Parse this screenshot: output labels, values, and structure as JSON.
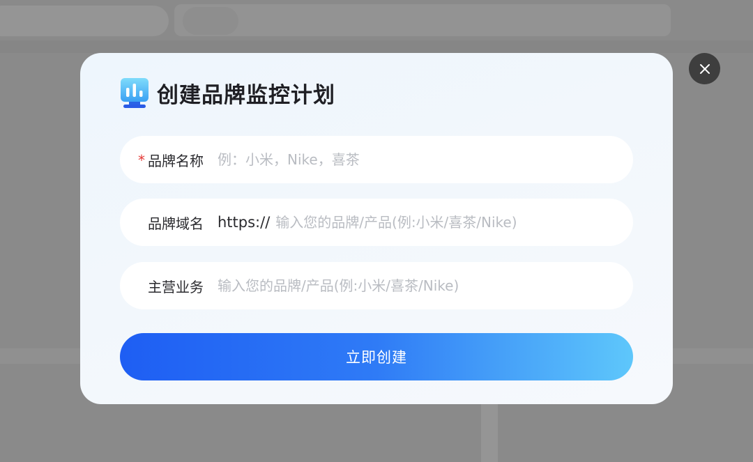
{
  "dialog": {
    "title": "创建品牌监控计划",
    "icon": "bar-chart-monitor-icon"
  },
  "close": {
    "icon": "close-icon"
  },
  "form": {
    "brand_name": {
      "required": true,
      "label": "品牌名称",
      "placeholder": "例：小米，Nike，喜茶",
      "value": ""
    },
    "brand_domain": {
      "label": "品牌域名",
      "prefix": "https://",
      "placeholder": "输入您的品牌/产品(例:小米/喜茶/Nike)",
      "value": ""
    },
    "main_business": {
      "label": "主营业务",
      "placeholder": "输入您的品牌/产品(例:小米/喜茶/Nike)",
      "value": ""
    },
    "submit_label": "立即创建"
  },
  "colors": {
    "accent_start": "#1e5ef3",
    "accent_end": "#5ec7fb",
    "required": "#e53935"
  }
}
